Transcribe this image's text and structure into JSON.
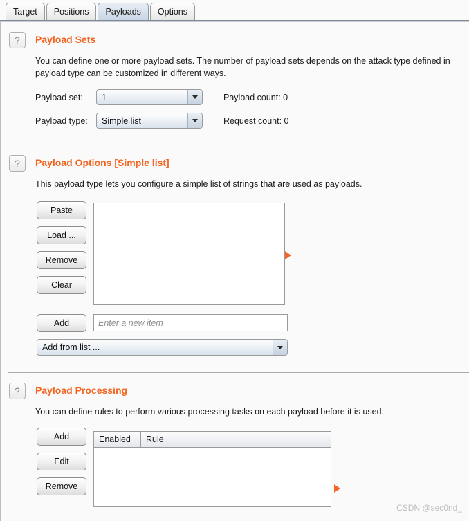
{
  "tabs": [
    {
      "label": "Target",
      "selected": false
    },
    {
      "label": "Positions",
      "selected": false
    },
    {
      "label": "Payloads",
      "selected": true
    },
    {
      "label": "Options",
      "selected": false
    }
  ],
  "payload_sets": {
    "help_icon": "?",
    "title": "Payload Sets",
    "description": "You can define one or more payload sets. The number of payload sets depends on the attack type defined in payload type can be customized in different ways.",
    "payload_set_label": "Payload set:",
    "payload_set_value": "1",
    "payload_type_label": "Payload type:",
    "payload_type_value": "Simple list",
    "payload_count_label": "Payload count: 0",
    "request_count_label": "Request count: 0"
  },
  "payload_options": {
    "help_icon": "?",
    "title": "Payload Options [Simple list]",
    "description": "This payload type lets you configure a simple list of strings that are used as payloads.",
    "buttons": [
      "Paste",
      "Load ...",
      "Remove",
      "Clear"
    ],
    "list_items": [],
    "add_button": "Add",
    "add_placeholder": "Enter a new item",
    "add_input_value": "",
    "add_from_list_value": "Add from list ..."
  },
  "payload_processing": {
    "help_icon": "?",
    "title": "Payload Processing",
    "description": "You can define rules to perform various processing tasks on each payload before it is used.",
    "buttons": [
      "Add",
      "Edit",
      "Remove"
    ],
    "columns": [
      "Enabled",
      "Rule"
    ],
    "rows": []
  },
  "watermark": "CSDN @sec0nd_",
  "colors": {
    "accent": "#f26522",
    "triangle": "#f4652b",
    "background": "#fafafa",
    "tab_selected": "#d5dfeb"
  }
}
